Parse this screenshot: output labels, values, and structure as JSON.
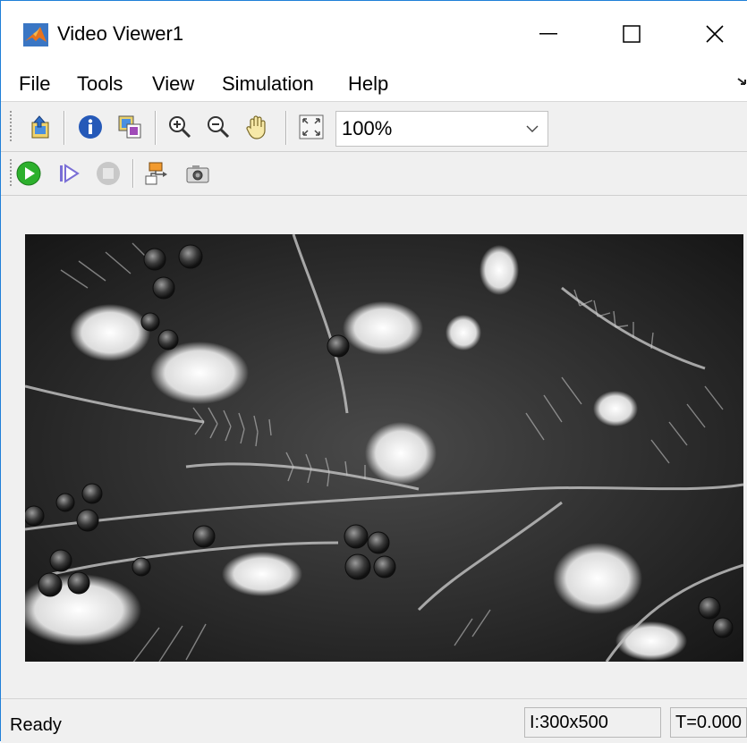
{
  "window": {
    "title": "Video Viewer1",
    "controls": {
      "minimize": "minimize",
      "maximize": "maximize",
      "close": "close"
    }
  },
  "menu": {
    "items": [
      {
        "label": "File"
      },
      {
        "label": "Tools"
      },
      {
        "label": "View"
      },
      {
        "label": "Simulation"
      },
      {
        "label": "Help"
      }
    ]
  },
  "toolbar": {
    "buttons_row1": [
      "print-to-figure-icon",
      "info-icon",
      "maintain-fit-icon",
      "zoom-in-icon",
      "zoom-out-icon",
      "pan-hand-icon",
      "fit-to-window-icon"
    ],
    "zoom": {
      "value": "100%"
    },
    "buttons_row2": [
      "run-icon",
      "step-forward-icon",
      "stop-icon",
      "highlight-block-icon",
      "snapshot-camera-icon"
    ]
  },
  "viewer": {
    "content": "grayscale video frame"
  },
  "status": {
    "text": "Ready",
    "image_size": "I:300x500",
    "time": "T=0.000"
  },
  "colors": {
    "window_border": "#1f7fd8",
    "background": "#f0f0f0",
    "run_green": "#2db02d"
  }
}
